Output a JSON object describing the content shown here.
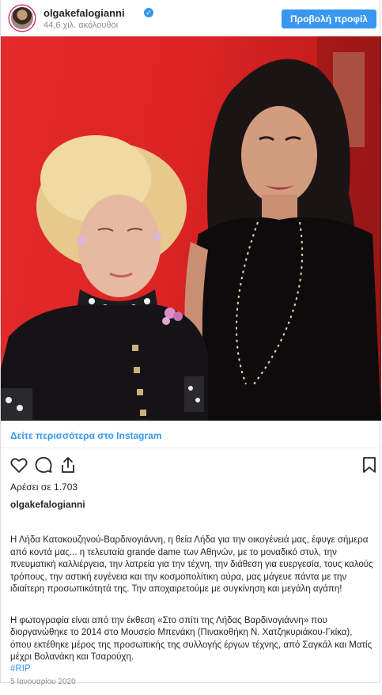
{
  "header": {
    "username": "olgakefalogianni",
    "followers": "44,6 χιλ. ακόλουθοι",
    "profile_button": "Προβολή προφίλ"
  },
  "post": {
    "more_link": "Δείτε περισσότερα στο Instagram",
    "likes": "Αρέσει σε 1.703",
    "owner": "olgakefalogianni",
    "caption_p1": "Η Λήδα Κατακουζηνού-Βαρδινογιάννη, η θεία Λήδα για την οικογένειά μας, έφυγε σήμερα από κοντά μας... η τελευταία grande dame των Αθηνών, με το μοναδικό στυλ, την πνευματική καλλιέργεια, την λατρεία για την τέχνη, την διάθεση για ευεργεσία, τους καλούς τρόπους, την αστική ευγένεια και την κοσμοπολίτικη αύρα, μας μάγευε πάντα με την ιδιαίτερη προσωπικότητά της. Την αποχαιρετούμε με συγκίνηση και μεγάλη αγάπη!",
    "caption_p2": "Η φωτογραφία είναι από την έκθεση «Στο σπίτι της Λήδας Βαρδινογιάννη» που διοργανώθηκε το 2014 στο Μουσείο Μπενάκη (Πινακοθήκη Ν. Χατζηκυριάκου-Γκίκα), όπου εκτέθηκε μέρος της προσωπικής της συλλογής έργων τέχνης, από Σαγκάλ και Ματίς μέχρι Βολανάκη και Τσαρούχη.",
    "hashtag": "#RIP",
    "timestamp": "5 Ιανουαρίου 2020"
  },
  "icons": {
    "verified": "verified-badge-icon",
    "like": "heart-icon",
    "comment": "comment-icon",
    "share": "share-icon",
    "save": "bookmark-icon"
  },
  "colors": {
    "accent": "#3897f0",
    "text": "#262626",
    "muted": "#8e8e8e",
    "photo_background": "#e32b2b"
  }
}
